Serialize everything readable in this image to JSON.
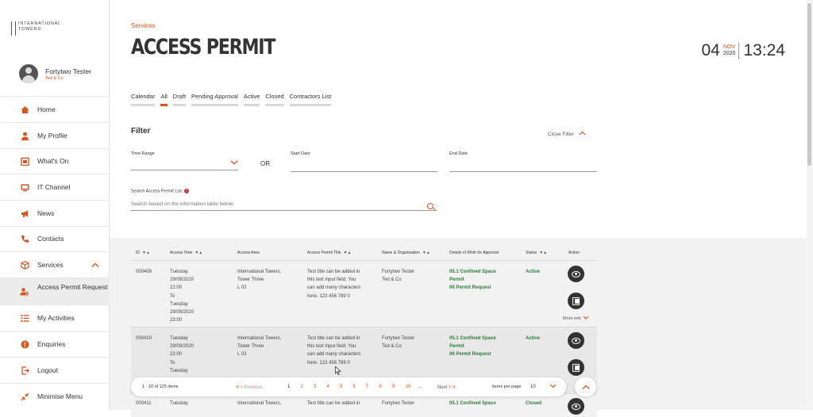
{
  "logo": {
    "line1": "INTERNATIONAL",
    "line2": "TOWERS"
  },
  "user": {
    "name": "Fortytwo Tester",
    "org": "Ted & Co"
  },
  "sidebar": {
    "items": [
      {
        "label": "Home",
        "icon": "home-icon"
      },
      {
        "label": "My Profile",
        "icon": "user-icon"
      },
      {
        "label": "What's On",
        "icon": "calendar-icon"
      },
      {
        "label": "IT Channel",
        "icon": "monitor-icon"
      },
      {
        "label": "News",
        "icon": "megaphone-icon"
      },
      {
        "label": "Contacts",
        "icon": "phone-icon"
      },
      {
        "label": "Services",
        "icon": "box-icon"
      },
      {
        "label": "Access Permit Request",
        "icon": "key-person-icon"
      },
      {
        "label": "My Activities",
        "icon": "list-icon"
      },
      {
        "label": "Enquiries",
        "icon": "alert-icon"
      },
      {
        "label": "Logout",
        "icon": "logout-icon"
      },
      {
        "label": "Minimise Menu",
        "icon": "collapse-icon"
      }
    ]
  },
  "header": {
    "breadcrumb": "Services",
    "title": "ACCESS PERMIT"
  },
  "clock": {
    "day": "04",
    "month": "NOV",
    "year": "2020",
    "time": "13:24"
  },
  "tabs": [
    {
      "label": "Calendar"
    },
    {
      "label": "All",
      "selected": true
    },
    {
      "label": "Draft"
    },
    {
      "label": "Pending Approval"
    },
    {
      "label": "Active"
    },
    {
      "label": "Closed"
    },
    {
      "label": "Contractors List"
    }
  ],
  "filter": {
    "title": "Filter",
    "close_label": "Close Filter",
    "time_range_label": "Time Range",
    "or_label": "OR",
    "start_date_label": "Start Date",
    "end_date_label": "End Date",
    "search_label": "Search Access Permit List",
    "search_placeholder": "Search based on the information table below"
  },
  "table": {
    "headers": [
      "ID",
      "Access Time",
      "Access Area",
      "Access Permit Title",
      "Name & Organisation",
      "Details of Work for Approval",
      "Status",
      "Action"
    ],
    "rows": [
      {
        "id": "000409",
        "time": [
          "Tuesday",
          "29/09/2020",
          "22:00",
          "To",
          "Tuesday",
          "29/09/2020",
          "23:00"
        ],
        "area": [
          "International Towers,",
          "Tower Three",
          "L 02"
        ],
        "title": [
          "Test title can be added in",
          "this text input field. You",
          "can add many characters",
          "here. 123 456 789 0"
        ],
        "name": [
          "Fortytwo Tester",
          "Ted & Co"
        ],
        "details": [
          "05.1 Confined Space",
          "Permit",
          "06 Permit Request"
        ],
        "status": "Active",
        "more": "More info"
      },
      {
        "id": "000410",
        "time": [
          "Tuesday",
          "29/09/2020",
          "22:00",
          "To",
          "Tuesday"
        ],
        "area": [
          "International Towers,",
          "Tower Three",
          "L 02"
        ],
        "title": [
          "Test title can be added in",
          "this text input field. You",
          "can add many characters",
          "here. 123 456 789 0"
        ],
        "name": [
          "Fortytwo Tester",
          "Ted & Co"
        ],
        "details": [
          "05.1 Confined Space",
          "Permit",
          "06 Permit Request"
        ],
        "status": "Active"
      },
      {
        "id": "000411",
        "time": [
          "Tuesday"
        ],
        "area": [
          "International Towers,"
        ],
        "title": [
          "Test title can be added in"
        ],
        "name": [
          "Fortytwo Tester"
        ],
        "details": [
          "05.1 Confined Space"
        ],
        "status": "Closed"
      }
    ]
  },
  "pager": {
    "items_text": "1 - 10 of 125 items",
    "previous": "Previous",
    "pages": [
      "1",
      "2",
      "3",
      "4",
      "5",
      "6",
      "7",
      "8",
      "9",
      "10",
      "..."
    ],
    "next": "Next",
    "items_per_page_label": "items per page",
    "items_per_page_value": "10"
  },
  "colors": {
    "accent": "#d9541e",
    "status_green": "#2d7a3a"
  }
}
